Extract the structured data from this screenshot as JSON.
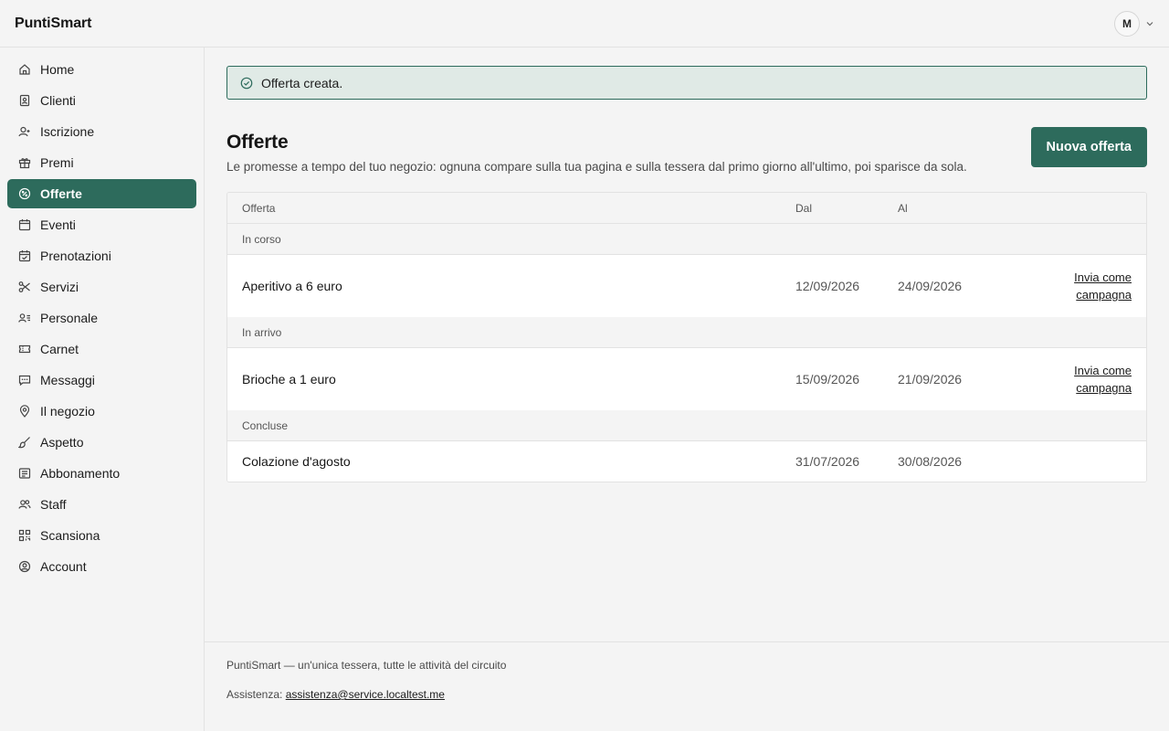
{
  "app": {
    "name": "PuntiSmart"
  },
  "user": {
    "initial": "M"
  },
  "sidebar": {
    "items": [
      {
        "label": "Home",
        "icon": "home-icon"
      },
      {
        "label": "Clienti",
        "icon": "contacts-icon"
      },
      {
        "label": "Iscrizione",
        "icon": "user-plus-icon"
      },
      {
        "label": "Premi",
        "icon": "gift-icon"
      },
      {
        "label": "Offerte",
        "icon": "discount-badge-icon",
        "active": true
      },
      {
        "label": "Eventi",
        "icon": "calendar-icon"
      },
      {
        "label": "Prenotazioni",
        "icon": "calendar-check-icon"
      },
      {
        "label": "Servizi",
        "icon": "scissors-icon"
      },
      {
        "label": "Personale",
        "icon": "user-list-icon"
      },
      {
        "label": "Carnet",
        "icon": "ticket-icon"
      },
      {
        "label": "Messaggi",
        "icon": "message-icon"
      },
      {
        "label": "Il negozio",
        "icon": "map-pin-icon"
      },
      {
        "label": "Aspetto",
        "icon": "brush-icon"
      },
      {
        "label": "Abbonamento",
        "icon": "receipt-icon"
      },
      {
        "label": "Staff",
        "icon": "users-icon"
      },
      {
        "label": "Scansiona",
        "icon": "qr-code-icon"
      },
      {
        "label": "Account",
        "icon": "user-circle-icon"
      }
    ]
  },
  "alert": {
    "text": "Offerta creata."
  },
  "page": {
    "title": "Offerte",
    "description": "Le promesse a tempo del tuo negozio: ognuna compare sulla tua pagina e sulla tessera dal primo giorno all'ultimo, poi sparisce da sola.",
    "new_button": "Nuova offerta"
  },
  "table": {
    "headers": {
      "name": "Offerta",
      "from": "Dal",
      "to": "Al"
    },
    "groups": [
      {
        "label": "In corso",
        "rows": [
          {
            "name": "Aperitivo a 6 euro",
            "from": "12/09/2026",
            "to": "24/09/2026",
            "action": "Invia come campagna"
          }
        ]
      },
      {
        "label": "In arrivo",
        "rows": [
          {
            "name": "Brioche a 1 euro",
            "from": "15/09/2026",
            "to": "21/09/2026",
            "action": "Invia come campagna"
          }
        ]
      },
      {
        "label": "Concluse",
        "rows": [
          {
            "name": "Colazione d'agosto",
            "from": "31/07/2026",
            "to": "30/08/2026",
            "action": ""
          }
        ]
      }
    ]
  },
  "footer": {
    "tagline": "PuntiSmart — un'unica tessera, tutte le attività del circuito",
    "support_label": "Assistenza:",
    "support_email": "assistenza@service.localtest.me"
  },
  "colors": {
    "accent": "#2d6b5c",
    "alert_bg": "#e0eae6",
    "page_bg": "#f4f4f4"
  }
}
